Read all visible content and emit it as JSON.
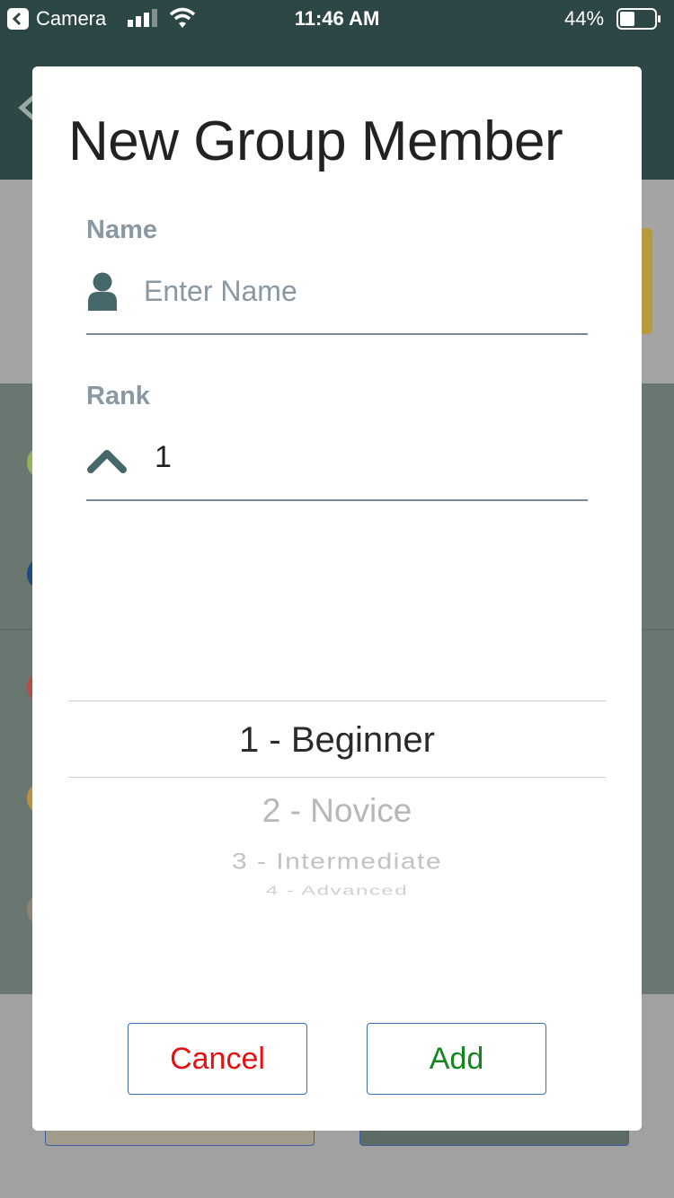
{
  "status_bar": {
    "back_app": "Camera",
    "time": "11:46 AM",
    "battery_percent": "44%",
    "battery_level": 0.44,
    "signal_bars": 3
  },
  "dialog": {
    "title": "New Group Member",
    "name_field": {
      "label": "Name",
      "placeholder": "Enter Name",
      "value": "",
      "icon": "person-icon"
    },
    "rank_field": {
      "label": "Rank",
      "value": "1",
      "icon": "chevron-up-icon"
    },
    "rank_picker": {
      "selected": "1 - Beginner",
      "options": [
        "1 - Beginner",
        "2 - Novice",
        "3 - Intermediate",
        "4 - Advanced"
      ]
    },
    "buttons": {
      "cancel": "Cancel",
      "add": "Add"
    }
  },
  "colors": {
    "header_bg": "#2d4746",
    "icon_teal": "#46686b",
    "label_gray": "#8a98a3",
    "cancel_red": "#e31111",
    "add_green": "#13861f",
    "button_border": "#3b6db5"
  }
}
